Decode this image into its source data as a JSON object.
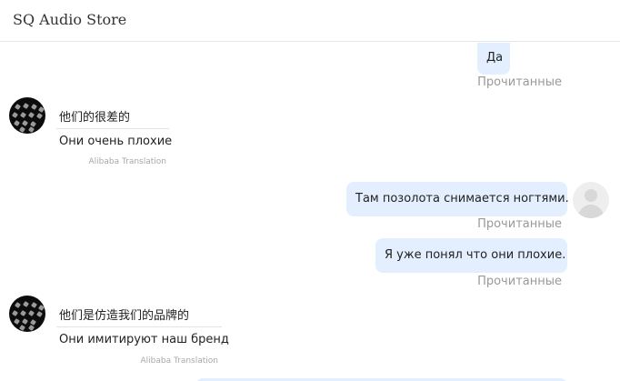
{
  "header": {
    "title": "SQ Audio Store"
  },
  "messages": [
    {
      "direction": "outgoing",
      "text": "Да",
      "status": "Прочитанные"
    },
    {
      "direction": "incoming",
      "original": "他们的很差的",
      "translated": "Они очень плохие",
      "credit": "Alibaba Translation"
    },
    {
      "direction": "outgoing",
      "text": "Там позолота снимается ногтями.",
      "status": "Прочитанные"
    },
    {
      "direction": "outgoing",
      "text": "Я уже понял что они плохие.",
      "status": "Прочитанные"
    },
    {
      "direction": "incoming",
      "original": "他们是仿造我们的品牌的",
      "translated": "Они имитируют наш бренд",
      "credit": "Alibaba Translation"
    }
  ],
  "colors": {
    "outgoing_bubble": "#e3efff",
    "status_text": "#999999",
    "credit_text": "#a8a8a8",
    "header_border": "#e6e6e6"
  },
  "icons": {
    "shop_avatar": "shop-avatar-icon",
    "user_avatar": "user-avatar-icon"
  }
}
